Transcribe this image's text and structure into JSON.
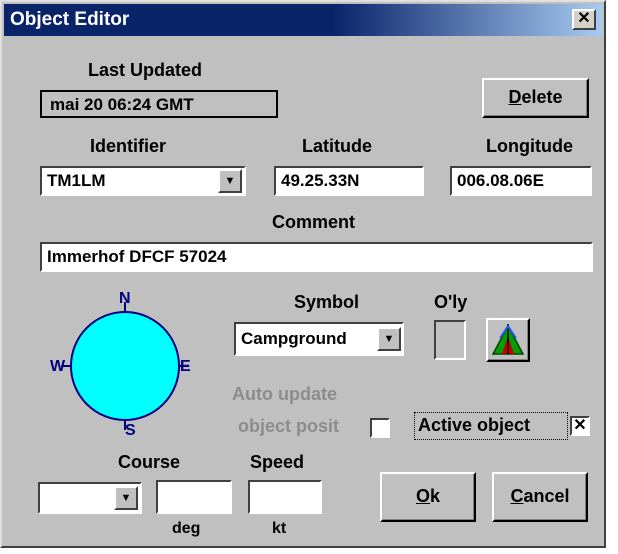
{
  "window": {
    "title": "Object Editor",
    "close_glyph": "✕"
  },
  "last_updated": {
    "label": "Last Updated",
    "value": "mai 20 06:24 GMT"
  },
  "delete_button": {
    "label_first": "D",
    "label_rest": "elete"
  },
  "identifier": {
    "label": "Identifier",
    "value": "TM1LM"
  },
  "latitude": {
    "label": "Latitude",
    "value": "49.25.33N"
  },
  "longitude": {
    "label": "Longitude",
    "value": "006.08.06E"
  },
  "comment": {
    "label": "Comment",
    "value": "Immerhof DFCF 57024"
  },
  "compass": {
    "north": "N",
    "south": "S",
    "east": "E",
    "west": "W",
    "fill_color": "#00ffff",
    "stroke_color": "#000080"
  },
  "symbol": {
    "label": "Symbol",
    "value": "Campground",
    "overlay_label": "O'ly",
    "icon": "tent-icon"
  },
  "auto_update": {
    "line1": "Auto update",
    "line2": "object posit",
    "checked": false
  },
  "active_object": {
    "label": "Active object",
    "checked": true,
    "mark": "✕"
  },
  "course": {
    "label": "Course",
    "unit": "deg",
    "value": ""
  },
  "speed": {
    "label": "Speed",
    "unit": "kt",
    "value": ""
  },
  "ok_button": {
    "label_first": "O",
    "label_rest": "k"
  },
  "cancel_button": {
    "label_first": "C",
    "label_rest": "ancel"
  },
  "dropdown_arrow": "▼"
}
